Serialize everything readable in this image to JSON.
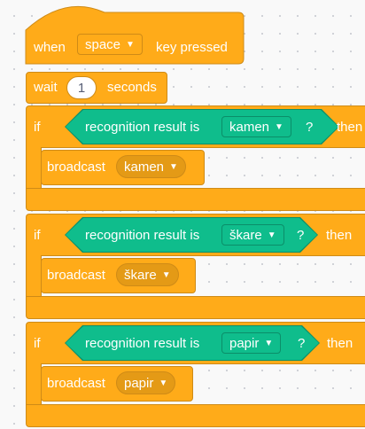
{
  "hat": {
    "when": "when",
    "key": "space",
    "key_pressed": "key pressed"
  },
  "wait": {
    "label": "wait",
    "value": "1",
    "unit": "seconds"
  },
  "ifs": [
    {
      "if": "if",
      "condition": "recognition result is",
      "option": "kamen",
      "q": "?",
      "then": "then",
      "broadcast": "broadcast",
      "message": "kamen"
    },
    {
      "if": "if",
      "condition": "recognition result is",
      "option": "škare",
      "q": "?",
      "then": "then",
      "broadcast": "broadcast",
      "message": "škare"
    },
    {
      "if": "if",
      "condition": "recognition result is",
      "option": "papir",
      "q": "?",
      "then": "then",
      "broadcast": "broadcast",
      "message": "papir"
    }
  ],
  "colors": {
    "events": "#ffab19",
    "control": "#ffab19",
    "extension": "#0fbd8c"
  }
}
